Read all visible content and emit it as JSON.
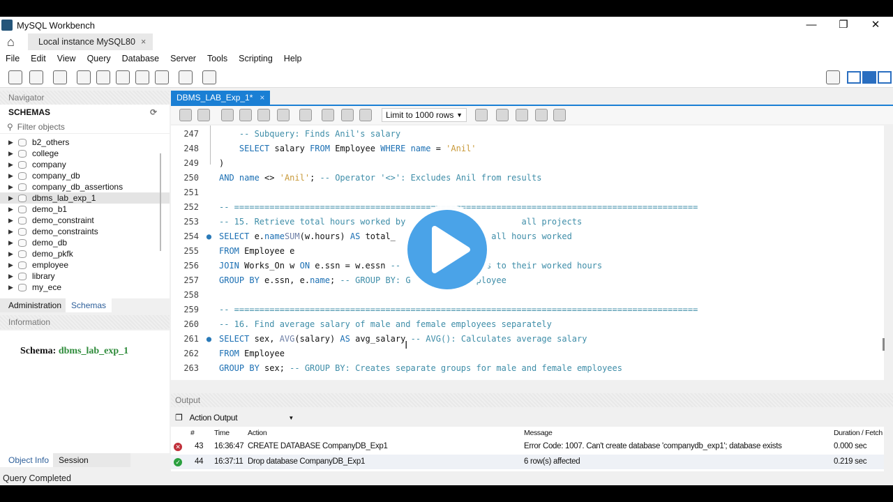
{
  "window": {
    "title": "MySQL Workbench",
    "minimize": "—",
    "restore": "❐",
    "close": "✕"
  },
  "connection_tab": {
    "label": "Local instance MySQL80",
    "close": "×"
  },
  "menu": [
    "File",
    "Edit",
    "View",
    "Query",
    "Database",
    "Server",
    "Tools",
    "Scripting",
    "Help"
  ],
  "navigator": {
    "header": "Navigator",
    "schemas_title": "SCHEMAS",
    "filter_placeholder": "Filter objects",
    "schemas": [
      "b2_others",
      "college",
      "company",
      "company_db",
      "company_db_assertions",
      "dbms_lab_exp_1",
      "demo_b1",
      "demo_constraint",
      "demo_constraints",
      "demo_db",
      "demo_pkfk",
      "employee",
      "library",
      "my_ece"
    ],
    "selected": "dbms_lab_exp_1",
    "tabs": [
      "Administration",
      "Schemas"
    ]
  },
  "information": {
    "header": "Information",
    "schema_label": "Schema:",
    "schema_value": "dbms_lab_exp_1",
    "tabs": [
      "Object Info",
      "Session"
    ]
  },
  "editor": {
    "tab": "DBMS_LAB_Exp_1*",
    "tab_close": "×",
    "limit": "Limit to 1000 rows",
    "lines": [
      {
        "n": "247",
        "t": [
          [
            "cm",
            "    -- Subquery: Finds Anil's salary"
          ]
        ]
      },
      {
        "n": "248",
        "t": [
          [
            "kw",
            "    SELECT "
          ],
          [
            "",
            "salary "
          ],
          [
            "kw",
            "FROM "
          ],
          [
            "",
            "Employee "
          ],
          [
            "kw",
            "WHERE "
          ],
          [
            "id",
            "name"
          ],
          [
            "",
            " = "
          ],
          [
            "st",
            "'Anil'"
          ]
        ]
      },
      {
        "n": "249",
        "t": [
          [
            "",
            ")"
          ]
        ]
      },
      {
        "n": "250",
        "t": [
          [
            "kw",
            "AND "
          ],
          [
            "id",
            "name"
          ],
          [
            "",
            " <> "
          ],
          [
            "st",
            "'Anil'"
          ],
          [
            "",
            "; "
          ],
          [
            "cm",
            "-- Operator '<>': Excludes Anil from results"
          ]
        ]
      },
      {
        "n": "251",
        "t": []
      },
      {
        "n": "252",
        "t": [
          [
            "cm",
            "-- ============================================================================================"
          ]
        ]
      },
      {
        "n": "253",
        "t": [
          [
            "cm",
            "-- 15. Retrieve total hours worked by "
          ],
          [
            "gap",
            "                      "
          ],
          [
            "cm",
            "all projects"
          ]
        ]
      },
      {
        "n": "254",
        "dot": true,
        "t": [
          [
            "kw",
            "SELECT "
          ],
          [
            "",
            "e."
          ],
          [
            "id",
            "name"
          ],
          [
            ",  "
          ],
          [
            "fn",
            "SUM"
          ],
          [
            "",
            "(w.hours) "
          ],
          [
            "kw",
            "AS "
          ],
          [
            "",
            "total_"
          ],
          [
            "gap",
            "                   "
          ],
          [
            "cm",
            "all hours worked"
          ]
        ]
      },
      {
        "n": "255",
        "t": [
          [
            "kw",
            "FROM "
          ],
          [
            "",
            "Employee e"
          ]
        ]
      },
      {
        "n": "256",
        "t": [
          [
            "kw",
            "JOIN "
          ],
          [
            "",
            "Works_On w "
          ],
          [
            "kw",
            "ON "
          ],
          [
            "",
            "e.ssn = w.essn "
          ],
          [
            "cm",
            "--"
          ],
          [
            "gap",
            "                 "
          ],
          [
            "cm",
            "s to their worked hours"
          ]
        ]
      },
      {
        "n": "257",
        "t": [
          [
            "kw",
            "GROUP BY "
          ],
          [
            "",
            "e.ssn, e."
          ],
          [
            "id",
            "name"
          ],
          [
            "",
            "; "
          ],
          [
            "cm",
            "-- GROUP BY: G"
          ],
          [
            "gap",
            "             "
          ],
          [
            "cm",
            "ployee"
          ]
        ]
      },
      {
        "n": "258",
        "t": []
      },
      {
        "n": "259",
        "t": [
          [
            "cm",
            "-- ============================================================================================"
          ]
        ]
      },
      {
        "n": "260",
        "t": [
          [
            "cm",
            "-- 16. Find average salary of male and female employees separately"
          ]
        ]
      },
      {
        "n": "261",
        "dot": true,
        "t": [
          [
            "kw",
            "SELECT "
          ],
          [
            "",
            "sex, "
          ],
          [
            "fn",
            "AVG"
          ],
          [
            "",
            "(salary) "
          ],
          [
            "kw",
            "AS "
          ],
          [
            "",
            "avg_salary "
          ],
          [
            "cm",
            "-- AVG(): Calculates average salary"
          ]
        ]
      },
      {
        "n": "262",
        "t": [
          [
            "kw",
            "FROM "
          ],
          [
            "",
            "Employee"
          ]
        ]
      },
      {
        "n": "263",
        "t": [
          [
            "kw",
            "GROUP BY "
          ],
          [
            "",
            "sex; "
          ],
          [
            "cm",
            "-- GROUP BY: Creates separate groups for male and female employees"
          ]
        ]
      }
    ]
  },
  "output": {
    "header": "Output",
    "mode": "Action Output",
    "columns": [
      "#",
      "Time",
      "Action",
      "Message",
      "Duration / Fetch"
    ],
    "rows": [
      {
        "status": "error",
        "num": "43",
        "time": "16:36:47",
        "action": "CREATE DATABASE CompanyDB_Exp1",
        "message": "Error Code: 1007. Can't create database 'companydb_exp1'; database exists",
        "duration": "0.000 sec"
      },
      {
        "status": "success",
        "num": "44",
        "time": "16:37:11",
        "action": "Drop database CompanyDB_Exp1",
        "message": "6 row(s) affected",
        "duration": "0.219 sec"
      }
    ]
  },
  "status_bar": "Query Completed",
  "colors": {
    "accent": "#1a7fd4",
    "schema_green": "#2e8b3a",
    "error": "#c0303a",
    "success": "#2aa040",
    "play_button": "#4aa3e8"
  }
}
